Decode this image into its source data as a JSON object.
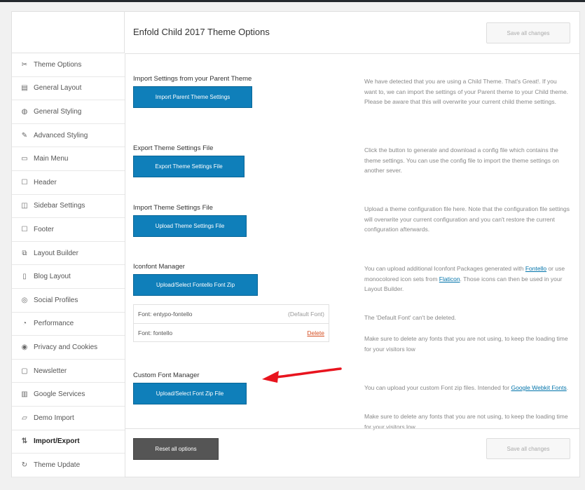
{
  "header": {
    "title": "Enfold Child 2017 Theme Options",
    "save_label": "Save all changes"
  },
  "sidebar": {
    "items": [
      {
        "label": "Theme Options",
        "icon": "wrench-icon",
        "glyph": "✂"
      },
      {
        "label": "General Layout",
        "icon": "layout-icon",
        "glyph": "▤"
      },
      {
        "label": "General Styling",
        "icon": "palette-icon",
        "glyph": "◍"
      },
      {
        "label": "Advanced Styling",
        "icon": "wand-icon",
        "glyph": "✎"
      },
      {
        "label": "Main Menu",
        "icon": "menu-icon",
        "glyph": "▭"
      },
      {
        "label": "Header",
        "icon": "header-icon",
        "glyph": "☐"
      },
      {
        "label": "Sidebar Settings",
        "icon": "sidebar-icon",
        "glyph": "◫"
      },
      {
        "label": "Footer",
        "icon": "footer-icon",
        "glyph": "☐"
      },
      {
        "label": "Layout Builder",
        "icon": "builder-icon",
        "glyph": "⧉"
      },
      {
        "label": "Blog Layout",
        "icon": "blog-icon",
        "glyph": "▯"
      },
      {
        "label": "Social Profiles",
        "icon": "social-icon",
        "glyph": "◎"
      },
      {
        "label": "Performance",
        "icon": "performance-icon",
        "glyph": "◔"
      },
      {
        "label": "Privacy and Cookies",
        "icon": "privacy-icon",
        "glyph": "◉"
      },
      {
        "label": "Newsletter",
        "icon": "newsletter-icon",
        "glyph": "▢"
      },
      {
        "label": "Google Services",
        "icon": "map-icon",
        "glyph": "▥"
      },
      {
        "label": "Demo Import",
        "icon": "import-icon",
        "glyph": "▱"
      },
      {
        "label": "Import/Export",
        "icon": "import-export-icon",
        "glyph": "⇅",
        "active": true
      },
      {
        "label": "Theme Update",
        "icon": "refresh-icon",
        "glyph": "↻"
      }
    ]
  },
  "sections": {
    "parent": {
      "title": "Import Settings from your Parent Theme",
      "button": "Import Parent Theme Settings",
      "desc": "We have detected that you are using a Child Theme. That's Great!. If you want to, we can import the settings of your Parent theme to your Child theme. Please be aware that this will overwrite your current child theme settings."
    },
    "export": {
      "title": "Export Theme Settings File",
      "button": "Export Theme Settings File",
      "desc": "Click the button to generate and download a config file which contains the theme settings. You can use the config file to import the theme settings on another sever."
    },
    "import_file": {
      "title": "Import Theme Settings File",
      "button": "Upload Theme Settings File",
      "desc": "Upload a theme configuration file here. Note that the configuration file settings will overwrite your current configuration and you can't restore the current configuration afterwards."
    },
    "iconfont": {
      "title": "Iconfont Manager",
      "button": "Upload/Select Fontello Font Zip",
      "desc_pre": "You can upload additional Iconfont Packages generated with ",
      "link1": "Fontello",
      "desc_mid": " or use monocolored icon sets from ",
      "link2": "Flaticon",
      "desc_post": ". Those icons can then be used in your Layout Builder.",
      "desc2": "The 'Default Font' can't be deleted.",
      "desc3": "Make sure to delete any fonts that you are not using, to keep the loading time for your visitors low",
      "fonts": [
        {
          "name": "Font: entypo-fontello",
          "action": "(Default Font)"
        },
        {
          "name": "Font: fontello",
          "action": "Delete"
        }
      ]
    },
    "custom_font": {
      "title": "Custom Font Manager",
      "button": "Upload/Select Font Zip File",
      "desc_pre": "You can upload your custom Font zip files. Intended for ",
      "link": "Google Webkit Fonts",
      "desc_post": ".",
      "desc2": "Make sure to delete any fonts that you are not using, to keep the loading time for your visitors low"
    }
  },
  "footer": {
    "reset_label": "Reset all options",
    "save_label": "Save all changes"
  },
  "colors": {
    "accent": "#0f7fba",
    "arrow": "#e8141e"
  }
}
